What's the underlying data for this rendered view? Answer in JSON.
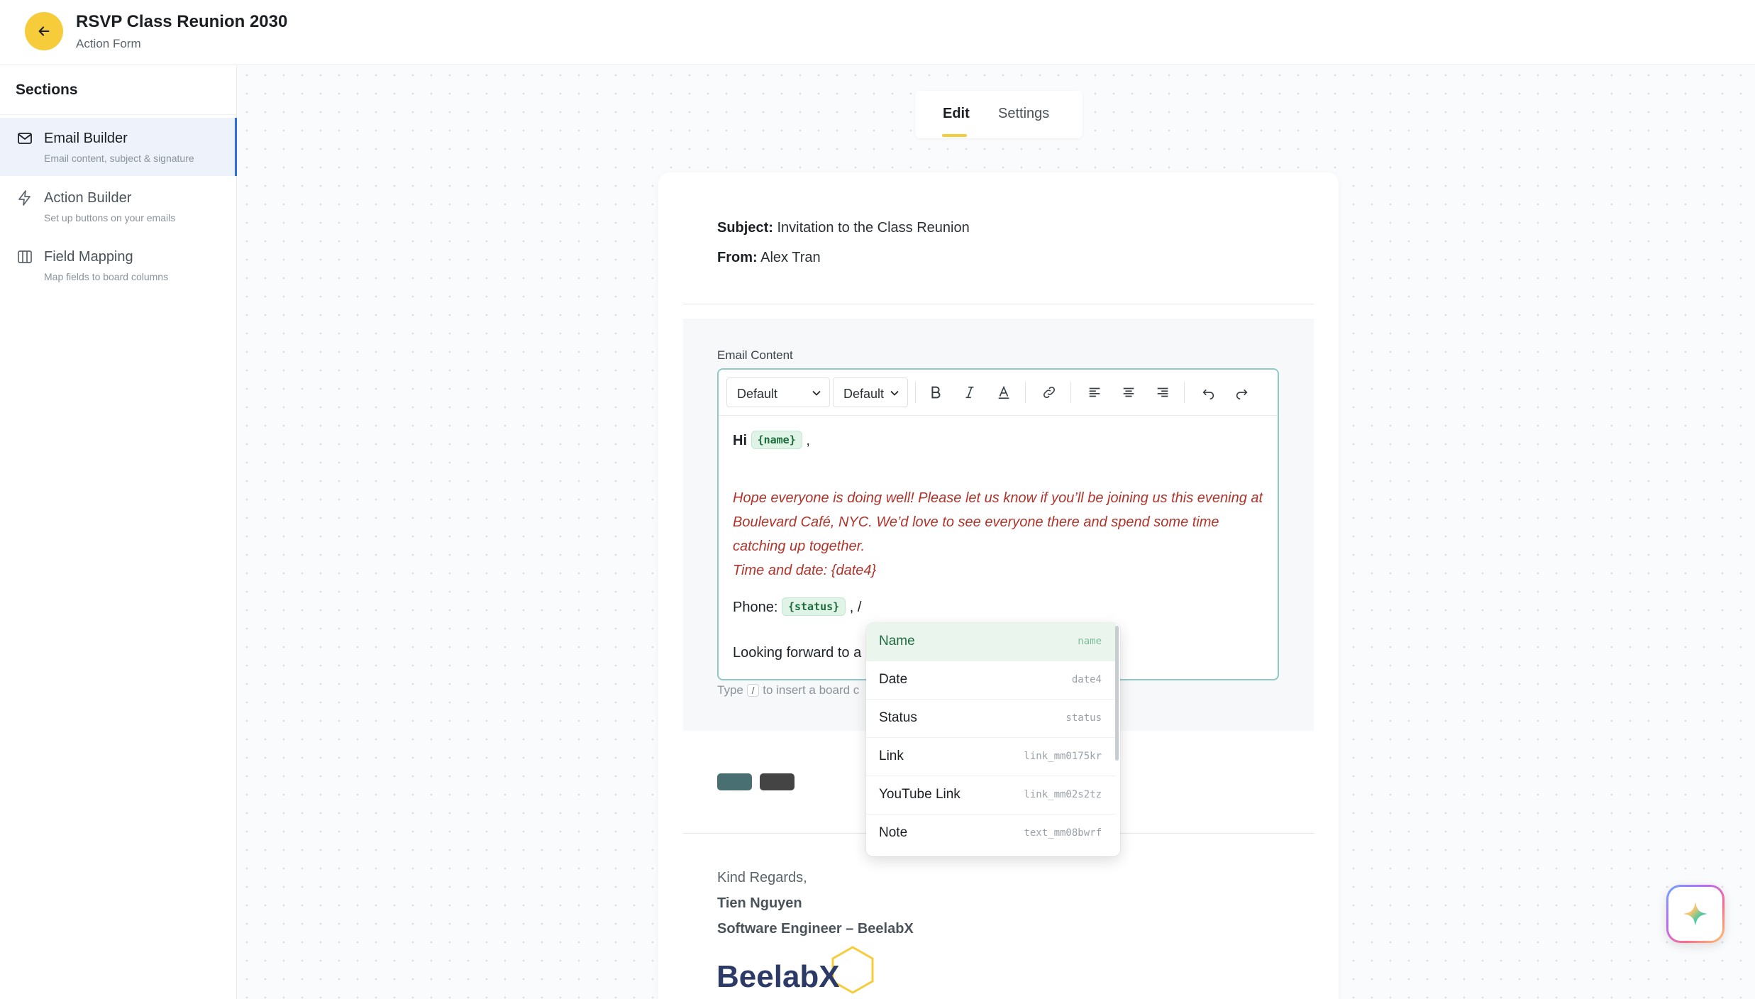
{
  "header": {
    "title": "RSVP Class Reunion 2030",
    "subtitle": "Action Form"
  },
  "sidebar": {
    "heading": "Sections",
    "items": [
      {
        "label": "Email Builder",
        "description": "Email content, subject & signature",
        "icon": "mail-icon",
        "active": true
      },
      {
        "label": "Action Builder",
        "description": "Set up buttons on your emails",
        "icon": "lightning-icon",
        "active": false
      },
      {
        "label": "Field Mapping",
        "description": "Map fields to board columns",
        "icon": "columns-icon",
        "active": false
      }
    ]
  },
  "tabs": {
    "edit": "Edit",
    "settings": "Settings",
    "active": "Edit"
  },
  "email": {
    "subject_label": "Subject:",
    "subject": "Invitation to the Class Reunion",
    "from_label": "From:",
    "from": "Alex Tran",
    "content_label": "Email Content",
    "toolbar": {
      "font_family": "Default",
      "font_size": "Default"
    },
    "body": {
      "greeting": "Hi",
      "name_chip": "{name}",
      "greeting_suffix": ",",
      "red_paragraph": "Hope everyone is doing well! Please let us know if you’ll be joining us this evening at Boulevard Café, NYC. We’d love to see everyone there and spend some time catching up together.",
      "red_time": "Time and date: {date4}",
      "phone_label": "Phone:",
      "status_chip": "{status}",
      "phone_suffix": ", /",
      "closing_partial": "Looking forward to a"
    },
    "hint_prefix": "Type",
    "hint_key": "/",
    "hint_suffix": "to insert a board c"
  },
  "buttons": {
    "colors": [
      "#4a6f72",
      "#444444"
    ]
  },
  "dropdown": {
    "items": [
      {
        "label": "Name",
        "key": "name",
        "active": true
      },
      {
        "label": "Date",
        "key": "date4",
        "active": false
      },
      {
        "label": "Status",
        "key": "status",
        "active": false
      },
      {
        "label": "Link",
        "key": "link_mm0175kr",
        "active": false
      },
      {
        "label": "YouTube Link",
        "key": "link_mm02s2tz",
        "active": false
      },
      {
        "label": "Note",
        "key": "text_mm08bwrf",
        "active": false
      }
    ]
  },
  "signature": {
    "regards": "Kind Regards,",
    "name": "Tien Nguyen",
    "title": "Software Engineer – BeelabX",
    "logo_text": "BeelabX"
  },
  "colors": {
    "accent_yellow": "#f7cc3b",
    "active_blue": "#2f6fde",
    "editor_border": "#8fc9c6",
    "chip_bg": "#dff3e6",
    "red_text": "#b0342b"
  }
}
